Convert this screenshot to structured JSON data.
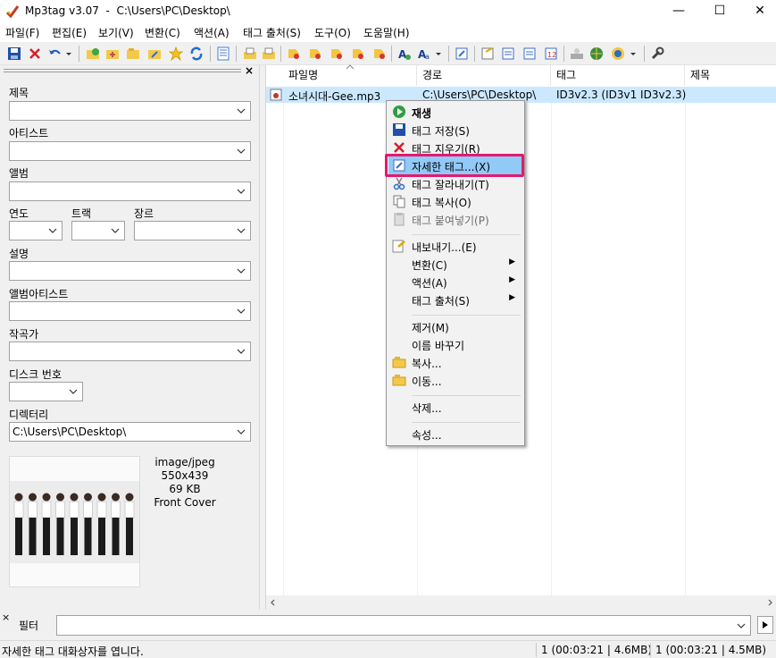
{
  "window": {
    "title": "Mp3tag v3.07  -  C:\\Users\\PC\\Desktop\\",
    "minimize": "—",
    "maximize": "☐",
    "close": "✕"
  },
  "menu": [
    "파일(F)",
    "편집(E)",
    "보기(V)",
    "변환(C)",
    "액션(A)",
    "태그 출처(S)",
    "도구(O)",
    "도움말(H)"
  ],
  "tag_panel": {
    "close_glyph": "×",
    "title_label": "제목",
    "artist_label": "아티스트",
    "album_label": "앨범",
    "year_label": "연도",
    "track_label": "트랙",
    "genre_label": "장르",
    "comment_label": "설명",
    "album_artist_label": "앨범아티스트",
    "composer_label": "작곡가",
    "disc_label": "디스크 번호",
    "directory_label": "디렉터리",
    "directory_value": "C:\\Users\\PC\\Desktop\\",
    "cover": {
      "mime": "image/jpeg",
      "dimensions": "550x439",
      "size": "69 KB",
      "type": "Front Cover"
    }
  },
  "file_list": {
    "columns": [
      "파일명",
      "경로",
      "태그",
      "제목"
    ],
    "rows": [
      {
        "filename": "소녀시대-Gee.mp3",
        "path": "C:\\Users\\PC\\Desktop\\",
        "tag": "ID3v2.3 (ID3v1 ID3v2.3)",
        "title": ""
      }
    ]
  },
  "context_menu": {
    "play": "재생",
    "save_tag": "태그 저장(S)",
    "remove_tag": "태그 지우기(R)",
    "extended_tags": "자세한 태그...(X)",
    "cut_tag": "태그 잘라내기(T)",
    "copy_tag": "태그 복사(O)",
    "paste_tag": "태그 붙여넣기(P)",
    "export": "내보내기...(E)",
    "convert": "변환(C)",
    "actions": "액션(A)",
    "tag_sources": "태그 출처(S)",
    "remove": "제거(M)",
    "rename": "이름 바꾸기",
    "copy": "복사...",
    "move": "이동...",
    "delete": "삭제...",
    "properties": "속성..."
  },
  "filter": {
    "label": "필터",
    "value": ""
  },
  "status": {
    "message": "자세한 태그 대화상자를 엽니다.",
    "selected": "1 (00:03:21 | 4.6MB)",
    "total": "1 (00:03:21 | 4.5MB)"
  },
  "colors": {
    "selection": "#cce8ff",
    "menu_hover": "#91c9f7",
    "highlight_box": "#e8186b"
  }
}
